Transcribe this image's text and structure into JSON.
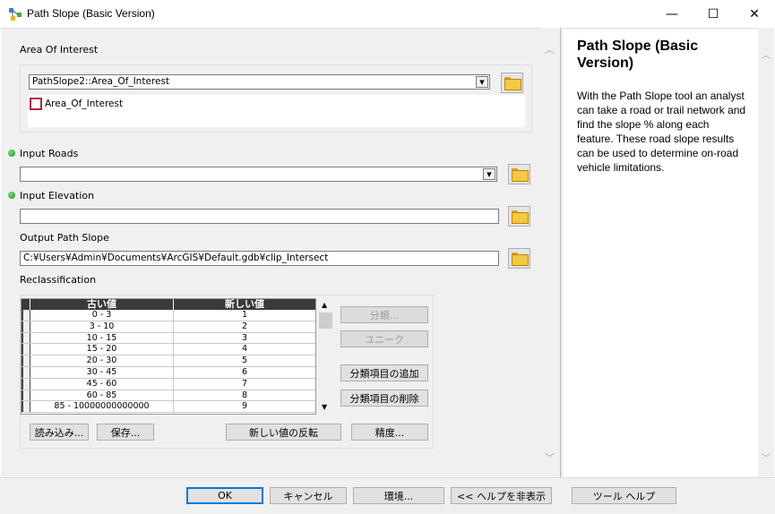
{
  "window": {
    "title": "Path Slope (Basic Version)",
    "min_glyph": "—",
    "max_glyph": "☐",
    "close_glyph": "✕"
  },
  "form": {
    "aoi": {
      "label": "Area Of Interest",
      "combo_value": "PathSlope2::Area_Of_Interest",
      "layer_name": "Area_Of_Interest"
    },
    "roads": {
      "label": "Input Roads",
      "value": ""
    },
    "elevation": {
      "label": "Input Elevation",
      "value": ""
    },
    "output": {
      "label": "Output Path Slope",
      "value": "C:¥Users¥Admin¥Documents¥ArcGIS¥Default.gdb¥clip_Intersect"
    },
    "reclass": {
      "label": "Reclassification",
      "col_old": "古い値",
      "col_new": "新しい値",
      "rows": [
        {
          "old": "0 - 3",
          "new": "1"
        },
        {
          "old": "3 - 10",
          "new": "2"
        },
        {
          "old": "10 - 15",
          "new": "3"
        },
        {
          "old": "15 - 20",
          "new": "4"
        },
        {
          "old": "20 - 30",
          "new": "5"
        },
        {
          "old": "30 - 45",
          "new": "6"
        },
        {
          "old": "45 - 60",
          "new": "7"
        },
        {
          "old": "60 - 85",
          "new": "8"
        },
        {
          "old": "85 - 10000000000000",
          "new": "9"
        }
      ],
      "buttons": {
        "classify": "分類...",
        "unique": "ユニーク",
        "add_entry": "分類項目の追加",
        "delete_entry": "分類項目の削除",
        "load": "読み込み...",
        "save": "保存...",
        "reverse": "新しい値の反転",
        "precision": "精度..."
      }
    }
  },
  "help": {
    "title": "Path Slope (Basic Version)",
    "body": "With the Path Slope tool an analyst can take a road or trail network and find the slope % along each feature. These road slope results can be used to determine on-road vehicle limitations."
  },
  "footer": {
    "ok": "OK",
    "cancel": "キャンセル",
    "environments": "環境...",
    "hide_help": "<< ヘルプを非表示",
    "tool_help": "ツール ヘルプ"
  },
  "colors": {
    "accent_focus": "#0078d7",
    "required_dot": "#1a8c1a",
    "layer_symbol": "#b0283a"
  }
}
